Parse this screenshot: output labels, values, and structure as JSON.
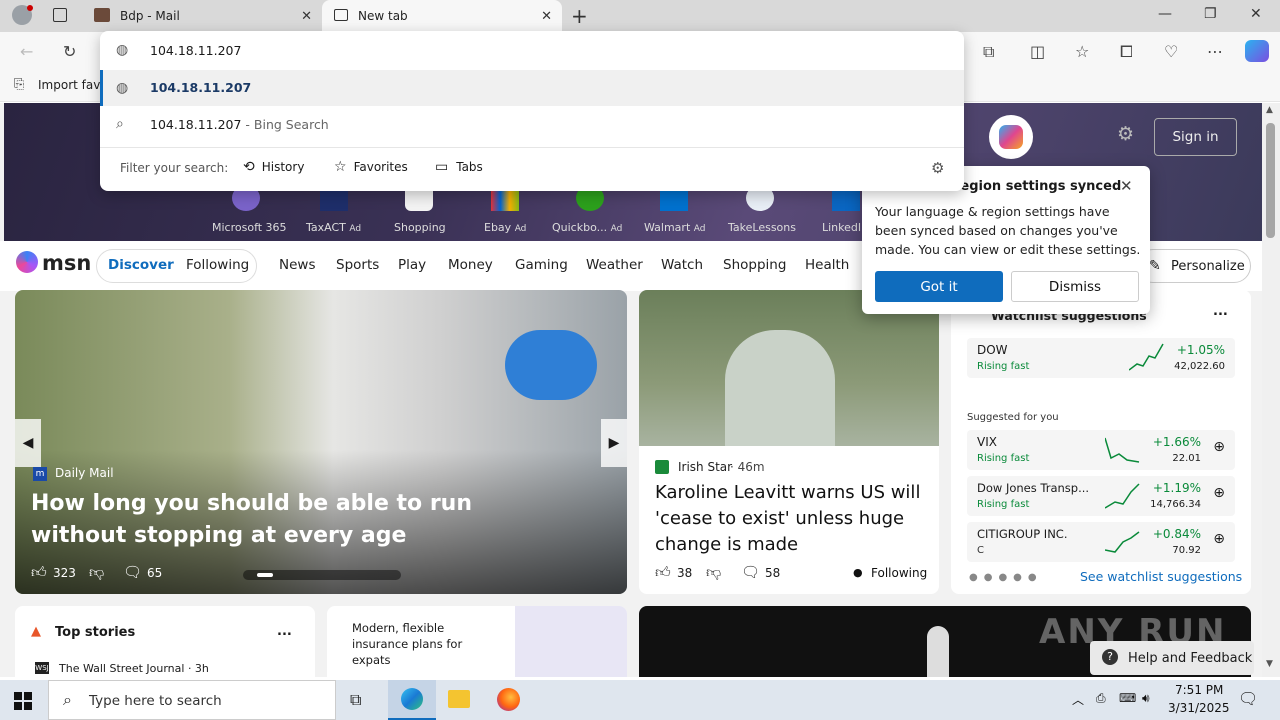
{
  "tabs": [
    {
      "title": "Bdp - Mail"
    },
    {
      "title": "New tab"
    }
  ],
  "address": {
    "value": "104.18.11.207"
  },
  "omnibox": {
    "suggestion_url": "104.18.11.207",
    "search_text": "104.18.11.207",
    "search_suffix": " - Bing Search",
    "filter_label": "Filter your search:",
    "filters": [
      "History",
      "Favorites",
      "Tabs"
    ]
  },
  "favorites_bar": {
    "import": "Import favo"
  },
  "banner": {
    "sign_in": "Sign in",
    "quick_links": [
      {
        "name": "Microsoft 365",
        "ad": ""
      },
      {
        "name": "TaxACT",
        "ad": "Ad"
      },
      {
        "name": "Shopping",
        "ad": ""
      },
      {
        "name": "Ebay",
        "ad": "Ad"
      },
      {
        "name": "Quickbo...",
        "ad": "Ad"
      },
      {
        "name": "Walmart",
        "ad": "Ad"
      },
      {
        "name": "TakeLessons",
        "ad": ""
      },
      {
        "name": "LinkedI",
        "ad": ""
      }
    ]
  },
  "msn": {
    "logo": "msn",
    "nav": [
      "Discover",
      "Following",
      "News",
      "Sports",
      "Play",
      "Money",
      "Gaming",
      "Weather",
      "Watch",
      "Shopping",
      "Health"
    ],
    "personalize": "Personalize"
  },
  "hero": {
    "source": "Daily Mail",
    "headline": "How long you should be able to run without stopping at every age",
    "likes": "323",
    "comments": "65"
  },
  "story2": {
    "source": "Irish Star",
    "time": "· 46m",
    "headline": "Karoline Leavitt warns US will 'cease to exist' unless huge change is made",
    "likes": "38",
    "comments": "58",
    "following": "Following"
  },
  "popup": {
    "title": "Language & region settings synced",
    "title_visible": "region settings synced",
    "body": "Your language & region settings have been synced based on changes you've made. You can view or edit these settings.",
    "got_it": "Got it",
    "dismiss": "Dismiss"
  },
  "watchlist": {
    "title": "Watchlist suggestions",
    "more": "...",
    "top": {
      "name": "DOW",
      "status": "Rising fast",
      "change": "+1.05%",
      "value": "42,022.60"
    },
    "suggested_label": "Suggested for you",
    "items": [
      {
        "name": "VIX",
        "status": "Rising fast",
        "change": "+1.66%",
        "value": "22.01"
      },
      {
        "name": "Dow Jones Transp...",
        "status": "Rising fast",
        "change": "+1.19%",
        "value": "14,766.34"
      },
      {
        "name": "CITIGROUP INC.",
        "status": "C",
        "change": "+0.84%",
        "value": "70.92"
      }
    ],
    "see_more": "See watchlist suggestions"
  },
  "top_stories": {
    "title": "Top stories",
    "more": "...",
    "first_source": "The Wall Street Journal · 3h"
  },
  "ad_card": {
    "text": "Modern, flexible insurance plans for expats"
  },
  "help": {
    "label": "Help and Feedback"
  },
  "watermark": {
    "text": "ANY RUN"
  },
  "taskbar": {
    "search_placeholder": "Type here to search",
    "time": "7:51 PM",
    "date": "3/31/2025"
  },
  "colors": {
    "accent": "#0f6cbd",
    "positive": "#0a8a3a",
    "msn_blue": "#0f6cbd"
  }
}
